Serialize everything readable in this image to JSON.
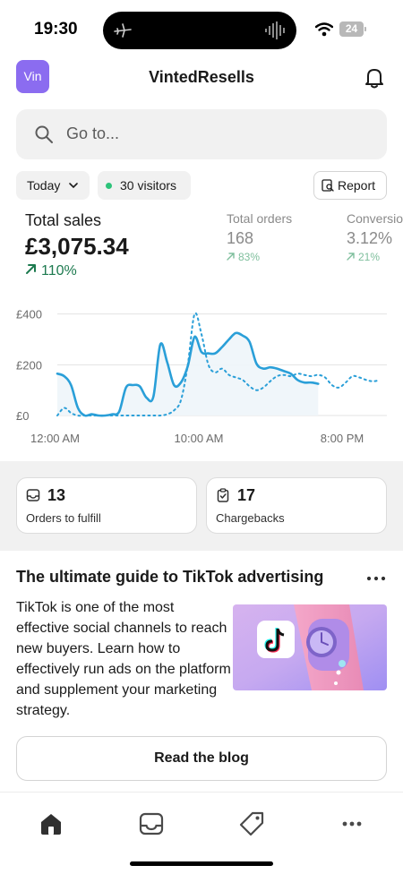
{
  "status_bar": {
    "time": "19:30",
    "battery": "24"
  },
  "header": {
    "avatar_text": "Vin",
    "store_name": "VintedResells",
    "bell_icon": "bell-icon"
  },
  "search": {
    "placeholder": "Go to..."
  },
  "filters": {
    "date_range": "Today",
    "visitors": "30 visitors",
    "report_label": "Report"
  },
  "metrics": {
    "total_sales": {
      "label": "Total sales",
      "value": "£3,075.34",
      "change": "110%"
    },
    "total_orders": {
      "label": "Total orders",
      "value": "168",
      "change": "83%"
    },
    "conversion": {
      "label": "Conversion",
      "value": "3.12%",
      "change": "21%"
    }
  },
  "chart_data": {
    "type": "line",
    "x_ticks": [
      "12:00 AM",
      "10:00 AM",
      "8:00 PM"
    ],
    "y_ticks": [
      "£0",
      "£200",
      "£400"
    ],
    "ylim": [
      0,
      420
    ],
    "grid": true,
    "series": [
      {
        "style": "solid",
        "color": "#2a9fd8",
        "x": [
          0,
          0.5,
          1,
          1.5,
          2,
          2.5,
          3,
          3.5,
          4,
          4.5,
          5,
          5.5,
          6,
          6.5,
          7,
          7.5,
          8,
          8.5,
          9,
          9.5,
          10,
          10.5,
          11,
          11.5,
          12,
          12.5,
          13,
          13.5,
          14,
          14.5,
          15,
          15.5,
          16,
          16.5,
          17,
          17.5,
          18,
          18.5,
          19
        ],
        "values": [
          165,
          155,
          120,
          30,
          0,
          5,
          0,
          0,
          5,
          15,
          110,
          120,
          115,
          70,
          75,
          280,
          210,
          120,
          130,
          195,
          310,
          250,
          245,
          245,
          270,
          300,
          325,
          315,
          290,
          205,
          185,
          190,
          185,
          175,
          165,
          140,
          130,
          130,
          125
        ]
      },
      {
        "style": "dotted",
        "color": "#2a9fd8",
        "x": [
          0,
          0.5,
          1,
          1.5,
          2,
          2.5,
          3,
          3.5,
          4,
          4.5,
          5,
          5.5,
          6,
          6.5,
          7,
          7.5,
          8,
          8.5,
          9,
          9.5,
          10,
          10.5,
          11,
          11.5,
          12,
          12.5,
          13,
          13.5,
          14,
          14.5,
          15,
          15.5,
          16,
          16.5,
          17,
          17.5,
          18,
          18.5,
          19,
          19.5,
          20,
          20.5,
          21,
          21.5,
          22,
          22.5,
          23,
          23.5
        ],
        "values": [
          0,
          30,
          10,
          0,
          0,
          0,
          0,
          0,
          0,
          0,
          0,
          0,
          0,
          0,
          0,
          0,
          5,
          20,
          60,
          200,
          400,
          320,
          200,
          170,
          185,
          160,
          150,
          140,
          115,
          100,
          110,
          135,
          155,
          160,
          155,
          165,
          160,
          155,
          160,
          150,
          120,
          110,
          130,
          155,
          150,
          140,
          135,
          140
        ]
      }
    ]
  },
  "cards": [
    {
      "count": "13",
      "label": "Orders to fulfill",
      "icon": "inbox-icon"
    },
    {
      "count": "17",
      "label": "Chargebacks",
      "icon": "clipboard-check-icon"
    }
  ],
  "guide": {
    "title": "The ultimate guide to TikTok advertising",
    "body": "TikTok is one of the most effective social channels to reach new buyers. Learn how to effectively run ads on the platform and supplement your marketing strategy.",
    "button": "Read the blog"
  },
  "tabbar": {
    "items": [
      "home-icon",
      "orders-icon",
      "products-icon",
      "more-icon"
    ]
  },
  "colors": {
    "accent": "#8b6cf0",
    "chart_line": "#2a9fd8",
    "positive": "#1d7a4f",
    "live_dot": "#2dc37a"
  }
}
